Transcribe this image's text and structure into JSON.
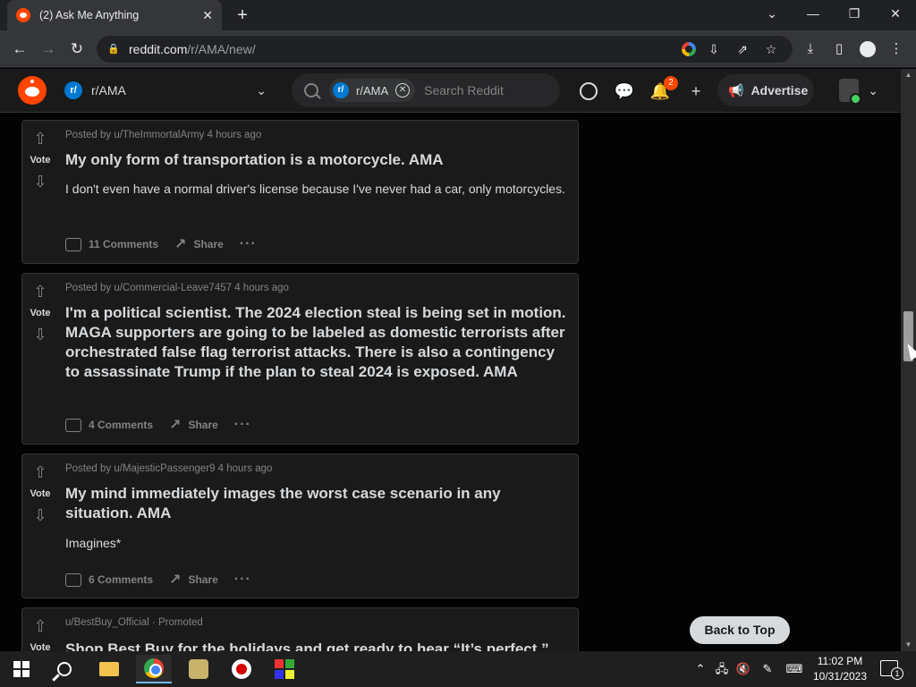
{
  "browser": {
    "tab_title": "(2) Ask Me Anything",
    "tab_close": "✕",
    "new_tab": "+",
    "window_controls": {
      "collapse": "⌄",
      "minimize": "—",
      "restore": "❐",
      "close": "✕"
    },
    "nav": {
      "back": "←",
      "forward": "→",
      "reload": "↻"
    },
    "url_host": "reddit.com",
    "url_path": "/r/AMA/new/"
  },
  "reddit_header": {
    "subreddit": "r/AMA",
    "subreddit_icon": "r/",
    "search_chip": "r/AMA",
    "search_placeholder": "Search Reddit",
    "notification_count": "2",
    "advertise_label": "Advertise"
  },
  "posts": [
    {
      "vote_label": "Vote",
      "meta": "Posted by u/TheImmortalArmy 4 hours ago",
      "title": "My only form of transportation is a motorcycle. AMA",
      "body": "I don't even have a normal driver's license because I've never had a car, only motorcycles.",
      "comments": "11 Comments",
      "share": "Share"
    },
    {
      "vote_label": "Vote",
      "meta": "Posted by u/Commercial-Leave7457 4 hours ago",
      "title": "I'm a political scientist. The 2024 election steal is being set in motion. MAGA supporters are going to be labeled as domestic terrorists after orchestrated false flag terrorist attacks. There is also a contingency to assassinate Trump if the plan to steal 2024 is exposed. AMA",
      "comments": "4 Comments",
      "share": "Share"
    },
    {
      "vote_label": "Vote",
      "meta": "Posted by u/MajesticPassenger9 4 hours ago",
      "title": "My mind immediately images the worst case scenario in any situation. AMA",
      "body": "Imagines*",
      "comments": "6 Comments",
      "share": "Share"
    },
    {
      "vote_label": "Vote",
      "meta": "u/BestBuy_Official · Promoted",
      "title": "Shop Best Buy for the holidays and get ready to hear “It’s perfect.”"
    }
  ],
  "back_to_top": "Back to Top",
  "taskbar": {
    "time": "11:02 PM",
    "date": "10/31/2023",
    "notification_count": "1"
  }
}
